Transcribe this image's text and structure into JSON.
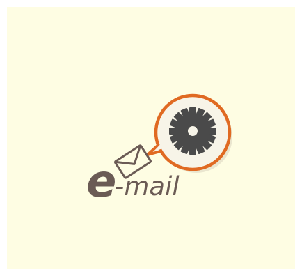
{
  "illustration": {
    "type": "e-mail settings icon",
    "logo_text_prefix": "e",
    "logo_text_suffix": "-mail",
    "icons": [
      "envelope-icon",
      "gear-icon",
      "speech-bubble-icon"
    ],
    "colors": {
      "background": "#fefde3",
      "text": "#6b5b55",
      "bubble_border": "#e06a22",
      "bubble_fill": "#f7f4e8",
      "gear": "#4a4a4a"
    }
  }
}
